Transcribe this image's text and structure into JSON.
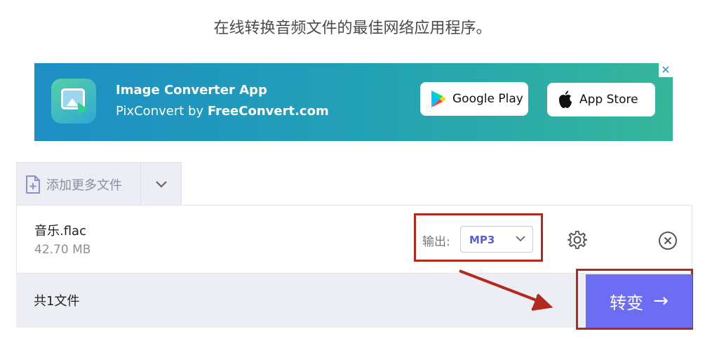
{
  "headline": "在线转换音频文件的最佳网络应用程序。",
  "ad": {
    "title": "Image Converter App",
    "subtitle_prefix": "PixConvert by ",
    "subtitle_brand": "FreeConvert.com",
    "google_play": "Google Play",
    "app_store": "App Store",
    "close": "✕"
  },
  "upload": {
    "add_more_label": "添加更多文件"
  },
  "file": {
    "name": "音乐.flac",
    "size": "42.70 MB",
    "output_label": "输出:",
    "format": "MP3"
  },
  "footer": {
    "count": "共1文件",
    "convert_label": "转变",
    "convert_arrow": "→"
  },
  "colors": {
    "accent": "#6d6df3",
    "highlight": "#b22a1d",
    "format_text": "#5b5fd8"
  }
}
